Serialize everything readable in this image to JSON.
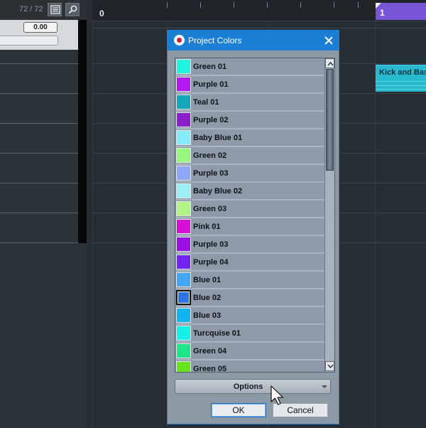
{
  "track_list": {
    "count": "72 / 72",
    "value_field": "0.00"
  },
  "toolbar_icons": [
    "list-icon",
    "search-icon"
  ],
  "ruler": {
    "start_label": "0",
    "cycle_label": "1"
  },
  "event": {
    "label": "Kick and Bass",
    "color": "#29b9cf"
  },
  "dialog": {
    "title": "Project Colors",
    "options_label": "Options",
    "ok_label": "OK",
    "cancel_label": "Cancel",
    "colors": [
      {
        "name": "Green 01",
        "swatch": "#1ff4e0",
        "selected": false
      },
      {
        "name": "Purple 01",
        "swatch": "#b219f3",
        "selected": false
      },
      {
        "name": "Teal 01",
        "swatch": "#16a5b9",
        "selected": false
      },
      {
        "name": "Purple 02",
        "swatch": "#8b1ecb",
        "selected": false
      },
      {
        "name": "Baby Blue 01",
        "swatch": "#84ecfb",
        "selected": false
      },
      {
        "name": "Green 02",
        "swatch": "#98f77c",
        "selected": false
      },
      {
        "name": "Purple 03",
        "swatch": "#8ea7f7",
        "selected": false
      },
      {
        "name": "Baby Blue 02",
        "swatch": "#9af0f4",
        "selected": false
      },
      {
        "name": "Green 03",
        "swatch": "#b1f585",
        "selected": false
      },
      {
        "name": "Pink 01",
        "swatch": "#d510d2",
        "selected": false
      },
      {
        "name": "Purple 03",
        "swatch": "#9a10e3",
        "selected": false
      },
      {
        "name": "Purple 04",
        "swatch": "#6f24ef",
        "selected": false
      },
      {
        "name": "Blue 01",
        "swatch": "#42a6f4",
        "selected": false
      },
      {
        "name": "Blue 02",
        "swatch": "#2b74e6",
        "selected": true
      },
      {
        "name": "Blue 03",
        "swatch": "#0fb4f1",
        "selected": false
      },
      {
        "name": "Turcquise 01",
        "swatch": "#16f0e6",
        "selected": false
      },
      {
        "name": "Green 04",
        "swatch": "#1ee688",
        "selected": false
      },
      {
        "name": "Green 05",
        "swatch": "#66e51c",
        "selected": false
      }
    ]
  }
}
